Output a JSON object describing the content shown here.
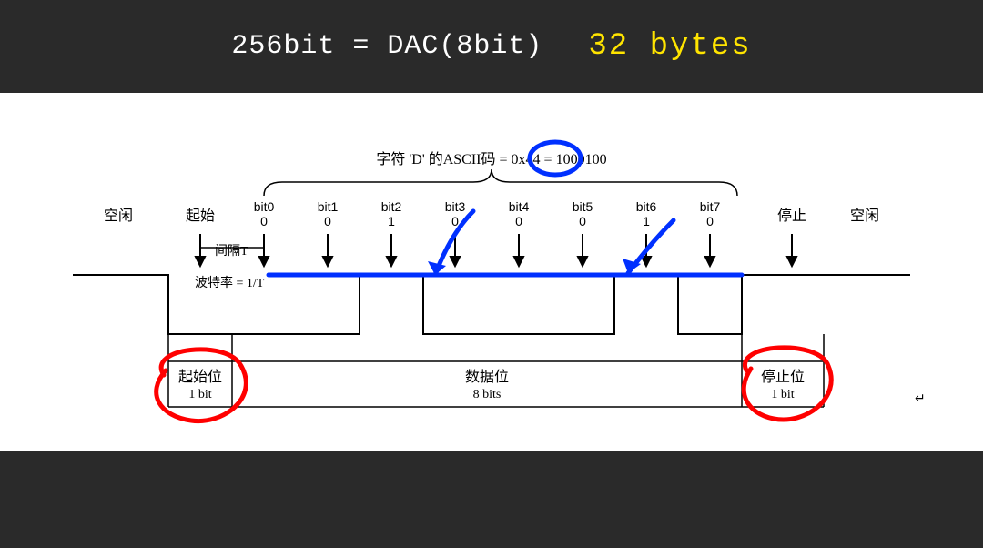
{
  "header": {
    "formula": "256bit = DAC(8bit)",
    "bytes_label": "32 bytes"
  },
  "diagram": {
    "top_caption_prefix": "字符 'D' 的ASCII码 = ",
    "top_caption_hex": "0x44",
    "top_caption_eq": " = ",
    "top_caption_bin": "1000100",
    "idle_label": "空闲",
    "start_label": "起始",
    "stop_label": "停止",
    "interval_label": "间隔T",
    "baudrate_label": "波特率 = 1/T",
    "bits": [
      {
        "name": "bit0",
        "value": "0"
      },
      {
        "name": "bit1",
        "value": "0"
      },
      {
        "name": "bit2",
        "value": "1"
      },
      {
        "name": "bit3",
        "value": "0"
      },
      {
        "name": "bit4",
        "value": "0"
      },
      {
        "name": "bit5",
        "value": "0"
      },
      {
        "name": "bit6",
        "value": "1"
      },
      {
        "name": "bit7",
        "value": "0"
      }
    ],
    "section_start": {
      "title": "起始位",
      "sub": "1 bit"
    },
    "section_data": {
      "title": "数据位",
      "sub": "8 bits"
    },
    "section_stop": {
      "title": "停止位",
      "sub": "1 bit"
    },
    "return_symbol": "↵"
  }
}
